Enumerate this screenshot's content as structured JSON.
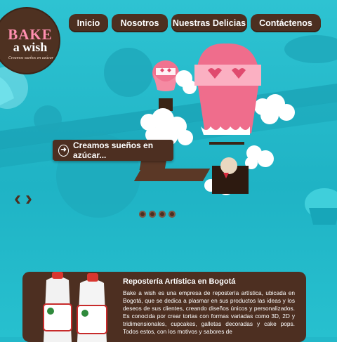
{
  "logo": {
    "line1": "BAKE",
    "line2": "a wish",
    "tagline": "Creamos sueños en azúcar"
  },
  "nav": [
    {
      "label": "Inicio"
    },
    {
      "label": "Nosotros"
    },
    {
      "label": "Nuestras Delicias"
    },
    {
      "label": "Contáctenos"
    }
  ],
  "slider": {
    "caption": "Creamos sueños en azúcar...",
    "slide_count": 4
  },
  "about": {
    "title": "Repostería Artística en Bogotá",
    "text": "Bake a wish es una empresa de repostería artística, ubicada en Bogotá, que se dedica a plasmar en sus productos las ideas y los deseos de sus clientes, creando diseños únicos y personalizados. Es conocida por crear tortas con formas variadas como 3D, 2D y tridimensionales, cupcakes, galletas decoradas y cake pops. Todos estos, con los motivos y sabores de"
  },
  "colors": {
    "brown": "#4d2f21",
    "pink": "#ff8fb0",
    "teal": "#23b8c9"
  }
}
